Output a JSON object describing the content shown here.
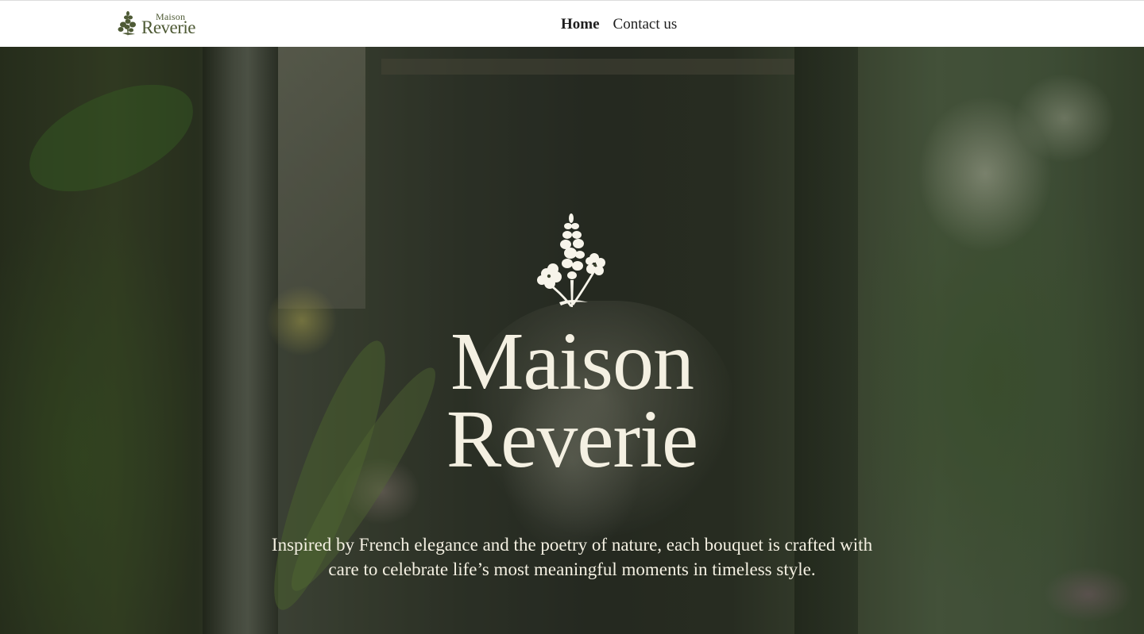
{
  "header": {
    "logo_line1": "Maison",
    "logo_line2": "Reverie",
    "nav": [
      {
        "label": "Home",
        "active": true
      },
      {
        "label": "Contact us",
        "active": false
      }
    ]
  },
  "hero": {
    "title_line1": "Maison",
    "title_line2": "Reverie",
    "tagline": "Inspired by French elegance and the poetry of nature, each bouquet is crafted with care to celebrate life’s most meaningful moments in timeless style."
  },
  "colors": {
    "logo_green": "#4e5a35",
    "hero_text": "#f4f0e2",
    "nav_text": "#1e1e1e"
  },
  "icons": {
    "logo": "flower-sprig-icon",
    "hero_emblem": "flower-bouquet-icon"
  }
}
